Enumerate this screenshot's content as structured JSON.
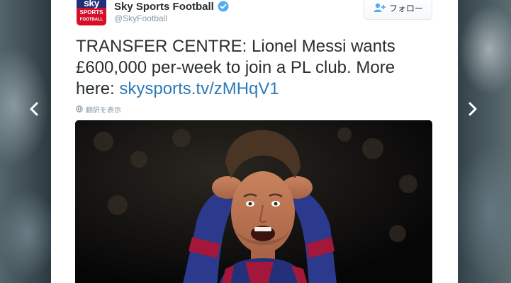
{
  "tweet": {
    "display_name": "Sky Sports Football",
    "handle": "@SkyFootball",
    "avatar_line1": "sky",
    "avatar_line2": "SPORTS",
    "avatar_line3": "FOOTBALL",
    "follow_label": "フォロー",
    "text": "TRANSFER CENTRE: Lionel Messi wants £600,000 per-week to join a PL club. More here: ",
    "link": "skysports.tv/zMHqV1",
    "translate_label": "翻訳を表示"
  },
  "colors": {
    "link": "#2b7bb9",
    "verified": "#55acee",
    "avatar_blue": "#1f2f78",
    "avatar_red": "#d5102a",
    "text": "#292f33",
    "muted": "#8899a6"
  },
  "icons": {
    "verified": "verified-badge-icon",
    "follow": "add-user-icon",
    "translate": "globe-icon",
    "prev": "chevron-left-icon",
    "next": "chevron-right-icon"
  }
}
